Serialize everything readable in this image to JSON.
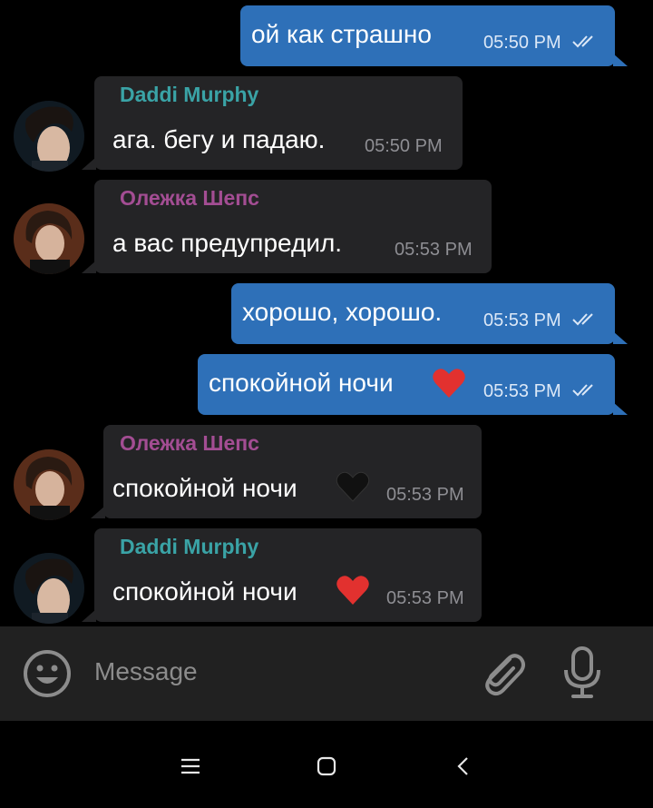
{
  "colors": {
    "outgoing_bubble": "#2e70b8",
    "incoming_bubble": "#242426",
    "sender_teal": "#3aa3a6",
    "sender_purple": "#a34d93",
    "background": "#000000",
    "heart_red": "#e2312f",
    "heart_black": "#111111"
  },
  "messages": [
    {
      "direction": "out",
      "text": "ой как страшно",
      "time": "05:50 PM",
      "status": "read"
    },
    {
      "direction": "in",
      "sender": "Daddi Murphy",
      "text": "ага. бегу и падаю.",
      "time": "05:50 PM"
    },
    {
      "direction": "in",
      "sender": "Олежка Шепс",
      "text": "а вас предупредил.",
      "time": "05:53 PM"
    },
    {
      "direction": "out",
      "text": "хорошо, хорошо.",
      "time": "05:53 PM",
      "status": "read"
    },
    {
      "direction": "out",
      "text": "спокойной ночи",
      "emoji": "red-heart",
      "time": "05:53 PM",
      "status": "read"
    },
    {
      "direction": "in",
      "sender": "Олежка Шепс",
      "text": "спокойной ночи",
      "emoji": "black-heart",
      "time": "05:53 PM"
    },
    {
      "direction": "in",
      "sender": "Daddi Murphy",
      "text": "спокойной ночи",
      "emoji": "red-heart",
      "time": "05:53 PM"
    }
  ],
  "composer": {
    "placeholder": "Message",
    "icons": [
      "emoji-icon",
      "attach-icon",
      "mic-icon"
    ]
  },
  "navbar": {
    "icons": [
      "menu-icon",
      "home-icon",
      "back-icon"
    ]
  }
}
